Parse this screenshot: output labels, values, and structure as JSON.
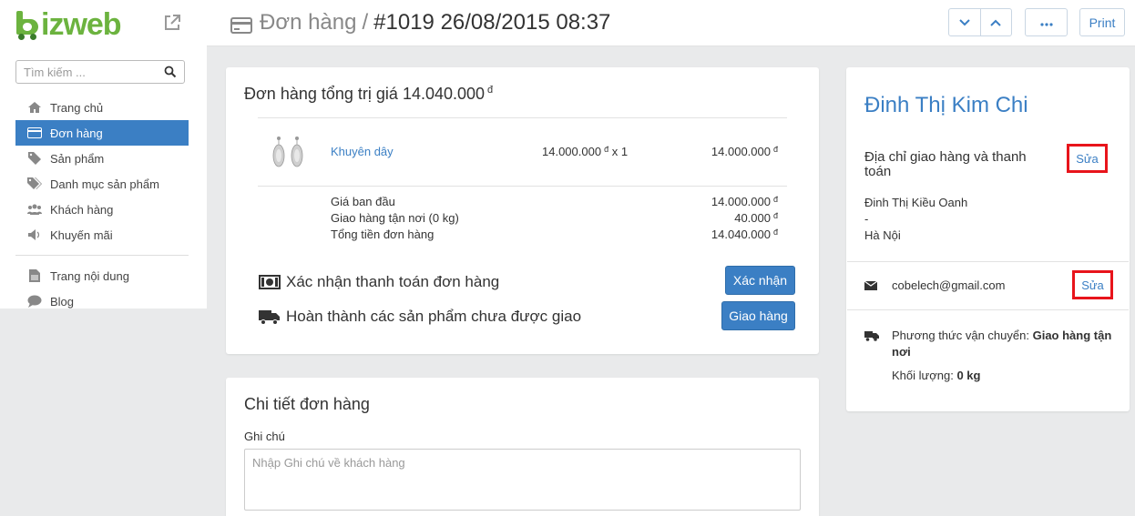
{
  "brand": {
    "logo_letter": "b",
    "logo_text": "izweb",
    "green": "#6cb33f"
  },
  "sidebar": {
    "search_placeholder": "Tìm kiếm ...",
    "items": [
      {
        "label": "Trang chủ",
        "icon": "home-icon",
        "active": false
      },
      {
        "label": "Đơn hàng",
        "icon": "credit-card-icon",
        "active": true
      },
      {
        "label": "Sản phẩm",
        "icon": "tag-icon",
        "active": false
      },
      {
        "label": "Danh mục sản phẩm",
        "icon": "tags-icon",
        "active": false
      },
      {
        "label": "Khách hàng",
        "icon": "users-icon",
        "active": false
      },
      {
        "label": "Khuyến mãi",
        "icon": "megaphone-icon",
        "active": false
      }
    ],
    "items2": [
      {
        "label": "Trang nội dung",
        "icon": "file-icon"
      },
      {
        "label": "Blog",
        "icon": "comment-icon"
      }
    ]
  },
  "header": {
    "section": "Đơn hàng",
    "separator": "/",
    "order_ref": "#1019 26/08/2015 08:37",
    "more_label": "···",
    "print_label": "Print"
  },
  "order": {
    "title_prefix": "Đơn hàng tổng trị giá",
    "title_value": "14.040.000",
    "currency": "đ",
    "items": [
      {
        "name": "Khuyên dây",
        "unit_price": "14.000.000",
        "qty_text": "x 1",
        "total": "14.000.000",
        "image": "earring-image"
      }
    ],
    "summary": [
      {
        "label": "Giá ban đầu",
        "value": "14.000.000"
      },
      {
        "label": "Giao hàng tận nơi (0 kg)",
        "value": "40.000"
      },
      {
        "label": "Tổng tiền đơn hàng",
        "value": "14.040.000"
      }
    ],
    "actions": [
      {
        "text": "Xác nhận thanh toán đơn hàng",
        "icon": "money-icon",
        "button": "Xác nhận"
      },
      {
        "text": "Hoàn thành các sản phẩm chưa được giao",
        "icon": "truck-icon",
        "button": "Giao hàng"
      }
    ]
  },
  "details": {
    "title": "Chi tiết đơn hàng",
    "note_label": "Ghi chú",
    "note_placeholder": "Nhập Ghi chú về khách hàng"
  },
  "customer": {
    "name": "Đinh Thị Kim Chi",
    "address_title": "Địa chỉ giao hàng và thanh toán",
    "edit_label": "Sửa",
    "address_lines": [
      "Đinh Thị Kiều Oanh",
      "-",
      "Hà Nội"
    ],
    "email": "cobelech@gmail.com",
    "shipping_label": "Phương thức vận chuyển:",
    "shipping_value": "Giao hàng tận nơi",
    "weight_label": "Khối lượng:",
    "weight_value": "0 kg"
  },
  "colors": {
    "accent": "#3b7fc4",
    "highlight_border": "#e8141b",
    "background": "#e9eaeb"
  }
}
